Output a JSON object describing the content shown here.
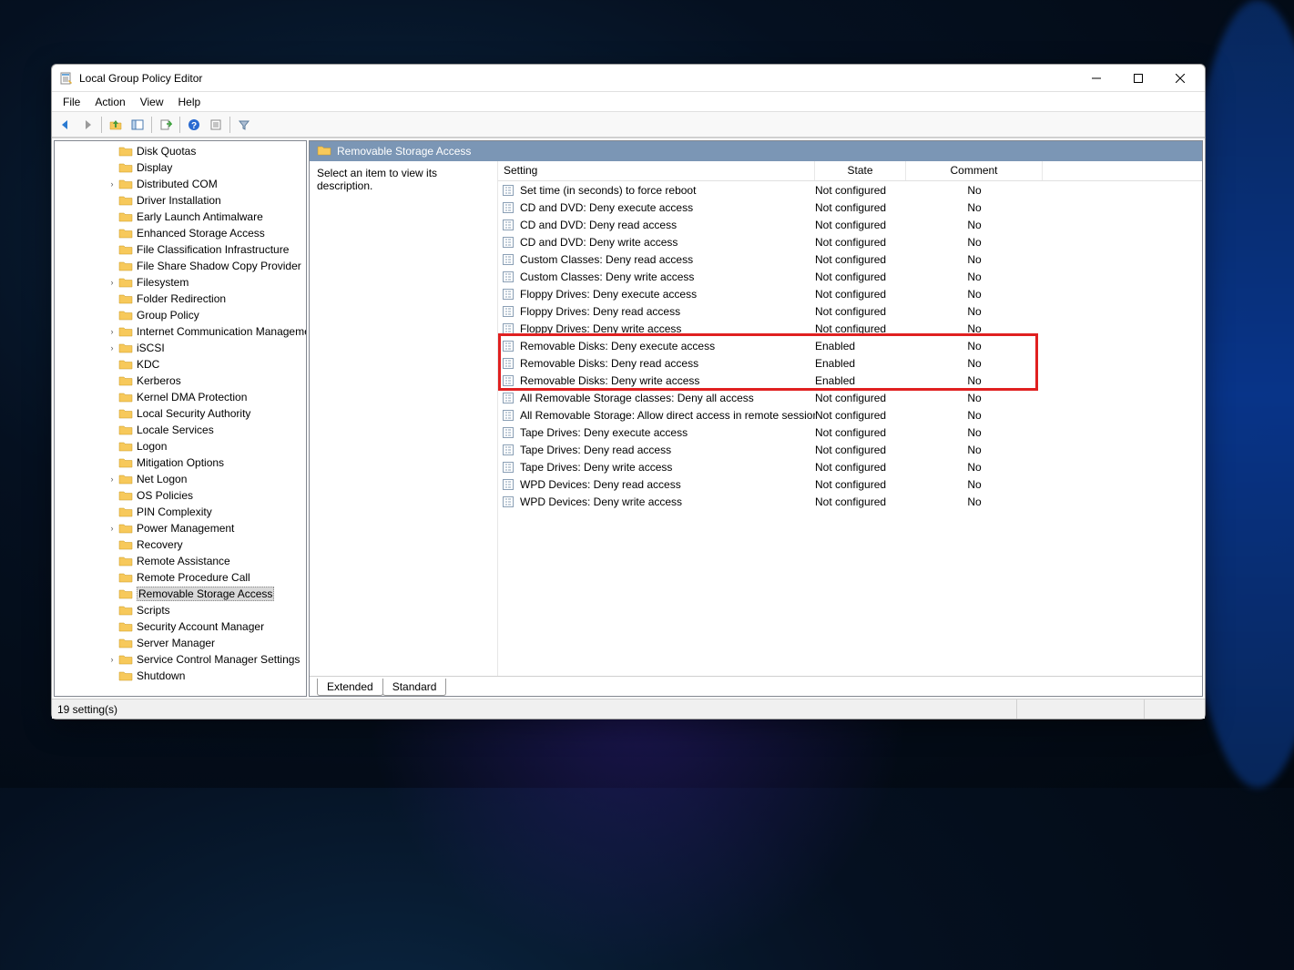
{
  "window": {
    "title": "Local Group Policy Editor"
  },
  "menubar": [
    "File",
    "Action",
    "View",
    "Help"
  ],
  "tree": {
    "indent_base": 72,
    "items": [
      {
        "label": "Disk Quotas",
        "expandable": false
      },
      {
        "label": "Display",
        "expandable": false
      },
      {
        "label": "Distributed COM",
        "expandable": true
      },
      {
        "label": "Driver Installation",
        "expandable": false
      },
      {
        "label": "Early Launch Antimalware",
        "expandable": false
      },
      {
        "label": "Enhanced Storage Access",
        "expandable": false
      },
      {
        "label": "File Classification Infrastructure",
        "expandable": false
      },
      {
        "label": "File Share Shadow Copy Provider",
        "expandable": false
      },
      {
        "label": "Filesystem",
        "expandable": true
      },
      {
        "label": "Folder Redirection",
        "expandable": false
      },
      {
        "label": "Group Policy",
        "expandable": false
      },
      {
        "label": "Internet Communication Management",
        "expandable": true
      },
      {
        "label": "iSCSI",
        "expandable": true
      },
      {
        "label": "KDC",
        "expandable": false
      },
      {
        "label": "Kerberos",
        "expandable": false
      },
      {
        "label": "Kernel DMA Protection",
        "expandable": false
      },
      {
        "label": "Local Security Authority",
        "expandable": false
      },
      {
        "label": "Locale Services",
        "expandable": false
      },
      {
        "label": "Logon",
        "expandable": false
      },
      {
        "label": "Mitigation Options",
        "expandable": false
      },
      {
        "label": "Net Logon",
        "expandable": true
      },
      {
        "label": "OS Policies",
        "expandable": false
      },
      {
        "label": "PIN Complexity",
        "expandable": false
      },
      {
        "label": "Power Management",
        "expandable": true
      },
      {
        "label": "Recovery",
        "expandable": false
      },
      {
        "label": "Remote Assistance",
        "expandable": false
      },
      {
        "label": "Remote Procedure Call",
        "expandable": false
      },
      {
        "label": "Removable Storage Access",
        "expandable": false,
        "selected": true
      },
      {
        "label": "Scripts",
        "expandable": false
      },
      {
        "label": "Security Account Manager",
        "expandable": false
      },
      {
        "label": "Server Manager",
        "expandable": false
      },
      {
        "label": "Service Control Manager Settings",
        "expandable": true
      },
      {
        "label": "Shutdown",
        "expandable": false
      }
    ]
  },
  "panel": {
    "title": "Removable Storage Access",
    "description": "Select an item to view its description.",
    "columns": {
      "setting": "Setting",
      "state": "State",
      "comment": "Comment"
    },
    "settings": [
      {
        "setting": "Set time (in seconds) to force reboot",
        "state": "Not configured",
        "comment": "No"
      },
      {
        "setting": "CD and DVD: Deny execute access",
        "state": "Not configured",
        "comment": "No"
      },
      {
        "setting": "CD and DVD: Deny read access",
        "state": "Not configured",
        "comment": "No"
      },
      {
        "setting": "CD and DVD: Deny write access",
        "state": "Not configured",
        "comment": "No"
      },
      {
        "setting": "Custom Classes: Deny read access",
        "state": "Not configured",
        "comment": "No"
      },
      {
        "setting": "Custom Classes: Deny write access",
        "state": "Not configured",
        "comment": "No"
      },
      {
        "setting": "Floppy Drives: Deny execute access",
        "state": "Not configured",
        "comment": "No"
      },
      {
        "setting": "Floppy Drives: Deny read access",
        "state": "Not configured",
        "comment": "No"
      },
      {
        "setting": "Floppy Drives: Deny write access",
        "state": "Not configured",
        "comment": "No"
      },
      {
        "setting": "Removable Disks: Deny execute access",
        "state": "Enabled",
        "comment": "No",
        "hl": true
      },
      {
        "setting": "Removable Disks: Deny read access",
        "state": "Enabled",
        "comment": "No",
        "hl": true
      },
      {
        "setting": "Removable Disks: Deny write access",
        "state": "Enabled",
        "comment": "No",
        "hl": true
      },
      {
        "setting": "All Removable Storage classes: Deny all access",
        "state": "Not configured",
        "comment": "No"
      },
      {
        "setting": "All Removable Storage: Allow direct access in remote sessions",
        "state": "Not configured",
        "comment": "No"
      },
      {
        "setting": "Tape Drives: Deny execute access",
        "state": "Not configured",
        "comment": "No"
      },
      {
        "setting": "Tape Drives: Deny read access",
        "state": "Not configured",
        "comment": "No"
      },
      {
        "setting": "Tape Drives: Deny write access",
        "state": "Not configured",
        "comment": "No"
      },
      {
        "setting": "WPD Devices: Deny read access",
        "state": "Not configured",
        "comment": "No"
      },
      {
        "setting": "WPD Devices: Deny write access",
        "state": "Not configured",
        "comment": "No"
      }
    ]
  },
  "tabs": {
    "extended": "Extended",
    "standard": "Standard"
  },
  "status": "19 setting(s)"
}
